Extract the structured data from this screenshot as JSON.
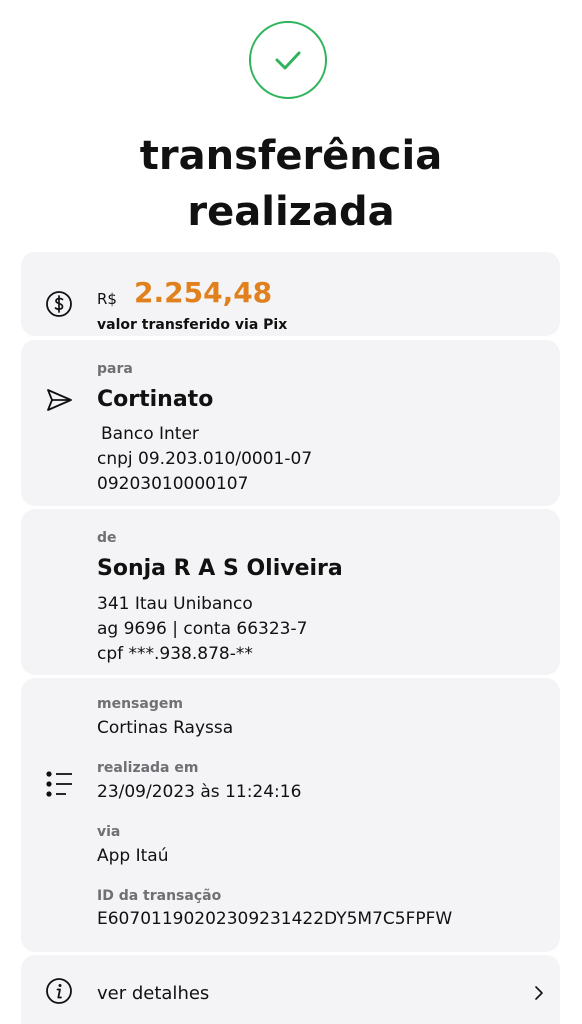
{
  "header": {
    "title_line1": "transferência",
    "title_line2": "realizada"
  },
  "amount_card": {
    "currency": "R$",
    "amount": "2.254,48",
    "description": "valor transferido via Pix"
  },
  "recipient_card": {
    "label": "para",
    "name": "Cortinato",
    "bank": "Banco Inter",
    "document": "cnpj 09.203.010/0001-07",
    "account": "09203010000107"
  },
  "sender_card": {
    "label": "de",
    "name": "Sonja R A S Oliveira",
    "bank": "341 Itau Unibanco",
    "account": "ag 9696 | conta 66323-7",
    "document": "cpf ***.938.878-**"
  },
  "info_card": {
    "message_label": "mensagem",
    "message": "Cortinas Rayssa",
    "date_label": "realizada em",
    "date": "23/09/2023 às 11:24:16",
    "via_label": "via",
    "via": "App Itaú",
    "id_label": "ID da transação",
    "id": "E60701190202309231422DY5M7C5FPFW"
  },
  "details": {
    "label": "ver detalhes"
  },
  "colors": {
    "success": "#2fb45c",
    "amount": "#e0811d",
    "card_bg": "#f4f4f6"
  },
  "icons": [
    "check-icon",
    "dollar-circle-icon",
    "send-icon",
    "list-icon",
    "info-icon",
    "chevron-right-icon"
  ]
}
